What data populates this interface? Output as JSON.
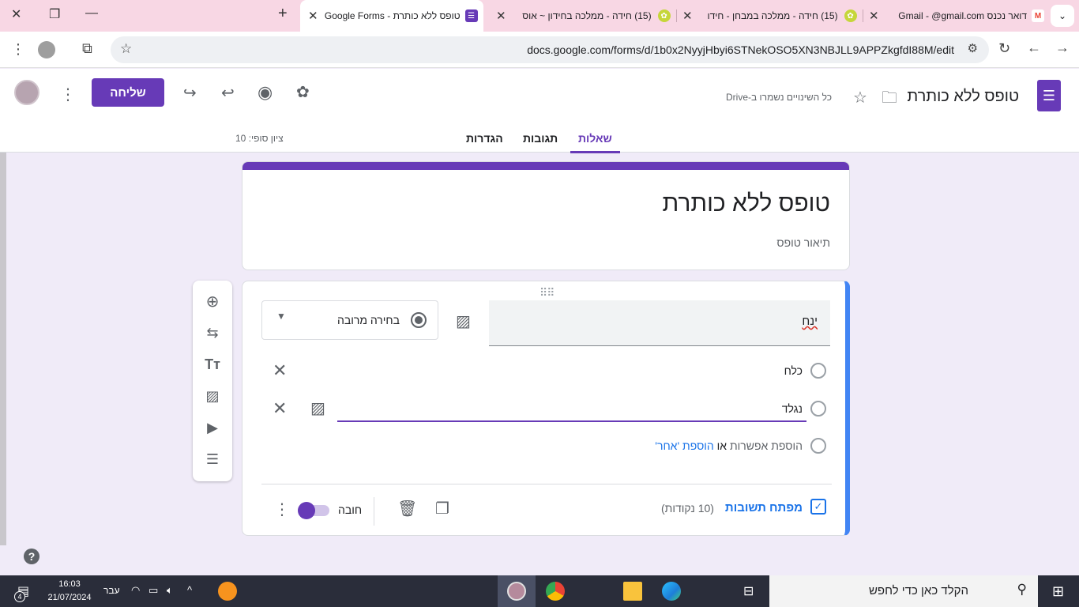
{
  "browser": {
    "tabs": [
      {
        "label": "דואר נכנס Gmail - ‎@gmail.com",
        "favicon": "gmail-icon"
      },
      {
        "label": "(15) חידה - ממלכה במבחן - חידו",
        "favicon": "puzzle-icon"
      },
      {
        "label": "(15) חידה - ממלכה בחידון ~ אוס",
        "favicon": "puzzle-icon"
      },
      {
        "label": "טופס ללא כותרת - Google Forms",
        "favicon": "forms-icon"
      }
    ],
    "url": "docs.google.com/forms/d/1b0x2NyyjHbyi6STNekOSO5XN3NBJLL9APPZkgfdI88M/edit"
  },
  "header": {
    "doc_title": "טופס ללא כותרת",
    "saved_status": "כל השינויים נשמרו ב-Drive",
    "send_label": "שליחה",
    "tabs": {
      "questions": "שאלות",
      "responses": "תגובות",
      "settings": "הגדרות"
    },
    "score_label": "ציון סופי: 10"
  },
  "form": {
    "title": "טופס ללא כותרת",
    "description": "תיאור טופס"
  },
  "question": {
    "text": "ינח",
    "type_label": "בחירה מרובה",
    "options": [
      "כלח",
      "נגלד"
    ],
    "add_option_label": "הוספת אפשרות",
    "or_label": "או",
    "add_other_label": "הוספת 'אחר'",
    "answer_key_label": "מפתח תשובות",
    "points_label": "(10 נקודות)",
    "required_label": "חובה",
    "required_on": true
  },
  "taskbar": {
    "search_placeholder": "הקלד כאן כדי לחפש",
    "time": "16:03",
    "date": "21/07/2024",
    "language": "עבר",
    "notifications": "4"
  },
  "colors": {
    "accent": "#673ab7",
    "page_bg": "#f0ebf8",
    "active_question": "#4285f4",
    "tabstrip": "#f8d7e4"
  }
}
